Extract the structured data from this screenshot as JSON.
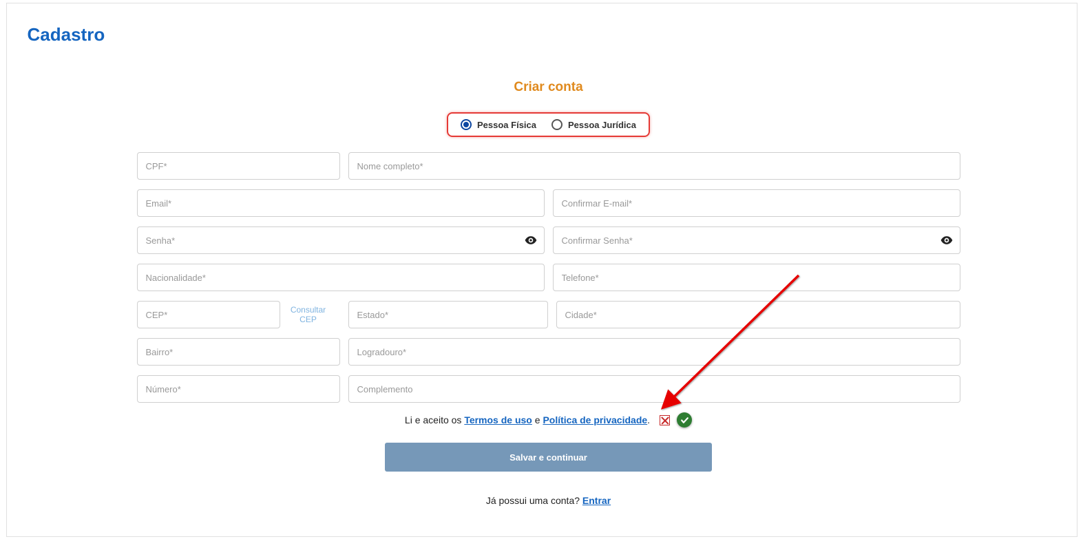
{
  "page_title": "Cadastro",
  "section_title": "Criar conta",
  "account_type": {
    "option1": "Pessoa Física",
    "option2": "Pessoa Jurídica",
    "selected": "fisica"
  },
  "fields": {
    "cpf": "CPF*",
    "nome": "Nome completo*",
    "email": "Email*",
    "confirm_email": "Confirmar E-mail*",
    "senha": "Senha*",
    "confirm_senha": "Confirmar Senha*",
    "nacionalidade": "Nacionalidade*",
    "telefone": "Telefone*",
    "cep": "CEP*",
    "consultar_cep": "Consultar CEP",
    "estado": "Estado*",
    "cidade": "Cidade*",
    "bairro": "Bairro*",
    "logradouro": "Logradouro*",
    "numero": "Número*",
    "complemento": "Complemento"
  },
  "terms": {
    "prefix": "Li e aceito os ",
    "termos": "Termos de uso",
    "middle": " e ",
    "politica": "Política de privacidade",
    "suffix": "."
  },
  "submit": "Salvar e continuar",
  "login_prompt": {
    "text": "Já possui uma conta? ",
    "link": "Entrar"
  }
}
